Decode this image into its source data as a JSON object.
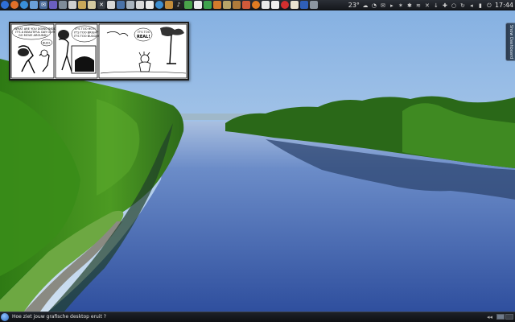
{
  "top_panel": {
    "launchers": [
      {
        "name": "kde-menu-icon",
        "glyph": "",
        "color": "#2f6fd6",
        "round": true
      },
      {
        "name": "firefox-icon",
        "glyph": "",
        "color": "#e0702a",
        "round": true
      },
      {
        "name": "browser-icon",
        "glyph": "",
        "color": "#3a8fd8",
        "round": true
      },
      {
        "name": "file-manager-icon",
        "glyph": "",
        "color": "#6aa0d8",
        "round": false
      },
      {
        "name": "mail-icon",
        "glyph": "✉",
        "color": "#4c6c9c",
        "round": false
      },
      {
        "name": "chat-icon",
        "glyph": "",
        "color": "#6a5fbf",
        "round": false
      },
      {
        "name": "settings-icon",
        "glyph": "",
        "color": "#7f8c99",
        "round": false
      },
      {
        "name": "terminal-icon",
        "glyph": "",
        "color": "#cfcfcf",
        "round": false
      },
      {
        "name": "archive-icon",
        "glyph": "",
        "color": "#c9a85a",
        "round": false
      },
      {
        "name": "notes-icon",
        "glyph": "",
        "color": "#d4c9a0",
        "round": false
      },
      {
        "name": "tools-icon",
        "glyph": "✕",
        "color": "#3a3f47",
        "round": false
      },
      {
        "name": "screen-icon",
        "glyph": "",
        "color": "#d8d8d8",
        "round": false
      },
      {
        "name": "monitor-icon",
        "glyph": "",
        "color": "#4a72a8",
        "round": false
      },
      {
        "name": "disk-icon",
        "glyph": "",
        "color": "#a9b3bd",
        "round": false
      },
      {
        "name": "graph-icon",
        "glyph": "",
        "color": "#d9d9d9",
        "round": false
      },
      {
        "name": "document-icon",
        "glyph": "",
        "color": "#eaeaea",
        "round": false
      },
      {
        "name": "globe-icon",
        "glyph": "",
        "color": "#3d8ed0",
        "round": true
      },
      {
        "name": "brush-icon",
        "glyph": "",
        "color": "#c28c3a",
        "round": false
      },
      {
        "name": "music-icon",
        "glyph": "♪",
        "color": "#222222",
        "round": false
      },
      {
        "name": "photo-icon",
        "glyph": "",
        "color": "#4aa34a",
        "round": false
      },
      {
        "name": "text-editor-icon",
        "glyph": "",
        "color": "#eeeeee",
        "round": false
      },
      {
        "name": "spreadsheet-icon",
        "glyph": "",
        "color": "#3fa34d",
        "round": false
      },
      {
        "name": "presentation-icon",
        "glyph": "",
        "color": "#d27b2c",
        "round": false
      },
      {
        "name": "game-icon",
        "glyph": "",
        "color": "#b8a468",
        "round": false
      },
      {
        "name": "package-icon",
        "glyph": "",
        "color": "#b07a3a",
        "round": false
      },
      {
        "name": "system-monitor-icon",
        "glyph": "",
        "color": "#d15a3a",
        "round": false
      },
      {
        "name": "media-player-icon",
        "glyph": "",
        "color": "#e07b22",
        "round": true
      },
      {
        "name": "image-viewer-icon",
        "glyph": "",
        "color": "#e8e8e8",
        "round": false
      },
      {
        "name": "cards-icon",
        "glyph": "",
        "color": "#eeeeee",
        "round": false
      },
      {
        "name": "bug-icon",
        "glyph": "",
        "color": "#d32f2f",
        "round": true
      },
      {
        "name": "calendar-icon",
        "glyph": "",
        "color": "#e9e3cf",
        "round": false
      },
      {
        "name": "flag-icon",
        "glyph": "",
        "color": "#2f5fb8",
        "round": false
      },
      {
        "name": "trash-icon",
        "glyph": "",
        "color": "#8c96a1",
        "round": false
      }
    ],
    "temperature": "23°",
    "clock": "17:44",
    "tray_icons": [
      {
        "name": "weather-icon",
        "glyph": "☁"
      },
      {
        "name": "clipboard-icon",
        "glyph": "◔"
      },
      {
        "name": "mail-notify-icon",
        "glyph": "✉"
      },
      {
        "name": "play-icon",
        "glyph": "▸"
      },
      {
        "name": "network-icon",
        "glyph": "✶"
      },
      {
        "name": "bluetooth-icon",
        "glyph": "✱"
      },
      {
        "name": "wifi-icon",
        "glyph": "≋"
      },
      {
        "name": "devices-icon",
        "glyph": "✕"
      },
      {
        "name": "download-icon",
        "glyph": "↓"
      },
      {
        "name": "updates-icon",
        "glyph": "✚"
      },
      {
        "name": "search-icon",
        "glyph": "○"
      },
      {
        "name": "sync-icon",
        "glyph": "↻"
      },
      {
        "name": "volume-icon",
        "glyph": "◂"
      },
      {
        "name": "battery-icon",
        "glyph": "▮"
      },
      {
        "name": "power-icon",
        "glyph": "⏻"
      }
    ]
  },
  "comic": {
    "panel1": {
      "bubble_lines": [
        "WHAT ARE YOU DOING INSIDE?",
        "IT'S A BEAUTIFUL DAY OUT!",
        "GO MOVE AROUND!"
      ],
      "reply": "BLEH."
    },
    "panel2": {
      "bubble_lines": [
        "IT'S TOO HOT!",
        "IT'S TOO BRIGHT!",
        "IT'S TOO BUGGY!"
      ]
    },
    "panel3": {
      "bubble_lines": [
        "IT'S TOO",
        "REAL!"
      ]
    }
  },
  "side_tab": {
    "label": "Show Dashboard"
  },
  "taskbar": {
    "window_title": "Hoe ziet jouw grafische desktop eruit ?",
    "arrows": "◂◂",
    "desktops": [
      {
        "active": true
      },
      {
        "active": false
      }
    ]
  },
  "colors": {
    "sky_top": "#8db4e3",
    "sky_horizon": "#c9dcef",
    "water": "#3d5ea8",
    "foliage": "#2f7d1f",
    "panel_bg": "#1b1e23"
  }
}
